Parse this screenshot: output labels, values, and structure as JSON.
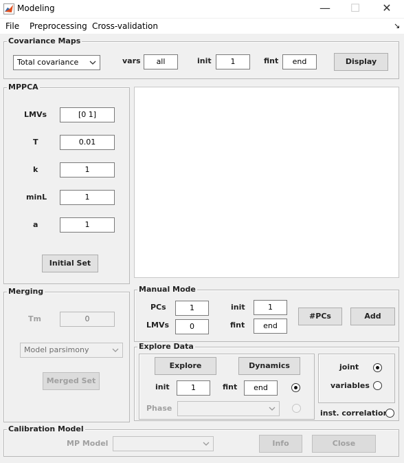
{
  "window": {
    "title": "Modeling",
    "minimize": "—",
    "maximize": "☐",
    "close": "✕"
  },
  "menu": {
    "file": "File",
    "preprocessing": "Preprocessing",
    "cross_validation": "Cross-validation",
    "corner_glyph": "↘"
  },
  "covariance_maps": {
    "title": "Covariance Maps",
    "type_selected": "Total covariance",
    "vars_label": "vars",
    "vars_value": "all",
    "init_label": "init",
    "init_value": "1",
    "fint_label": "fint",
    "fint_value": "end",
    "display_button": "Display"
  },
  "mppca": {
    "title": "MPPCA",
    "lmvs_label": "LMVs",
    "lmvs_value": "[0 1]",
    "t_label": "T",
    "t_value": "0.01",
    "k_label": "k",
    "k_value": "1",
    "minl_label": "minL",
    "minl_value": "1",
    "a_label": "a",
    "a_value": "1",
    "initial_set_button": "Initial Set"
  },
  "merging": {
    "title": "Merging",
    "tm_label": "Tm",
    "tm_value": "0",
    "criterion_selected": "Model parsimony",
    "merged_set_button": "Merged Set"
  },
  "manual_mode": {
    "title": "Manual Mode",
    "pcs_label": "PCs",
    "pcs_value": "1",
    "lmvs_label": "LMVs",
    "lmvs_value": "0",
    "init_label": "init",
    "init_value": "1",
    "fint_label": "fint",
    "fint_value": "end",
    "npcs_button": "#PCs",
    "add_button": "Add"
  },
  "explore_data": {
    "title": "Explore Data",
    "explore_button": "Explore",
    "dynamics_button": "Dynamics",
    "init_label": "init",
    "init_value": "1",
    "fint_label": "fint",
    "fint_value": "end",
    "phase_label": "Phase",
    "phase_selected": "",
    "joint_label": "joint",
    "variables_label": "variables",
    "inst_corr_label": "inst. correlation"
  },
  "calibration_model": {
    "title": "Calibration Model",
    "mp_model_label": "MP Model",
    "mp_model_selected": "",
    "info_button": "Info",
    "close_button": "Close"
  }
}
